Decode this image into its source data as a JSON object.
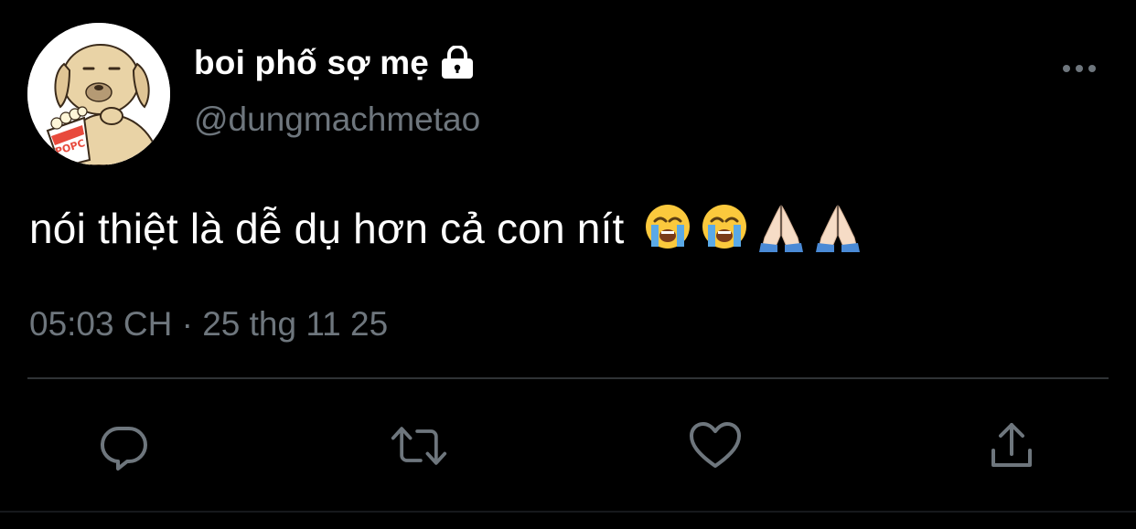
{
  "user": {
    "display_name": "boi phố sợ mẹ",
    "handle": "@dungmachmetao",
    "protected_icon": "lock-icon",
    "avatar_text": "POPC"
  },
  "tweet": {
    "text": "nói thiệt là dễ dụ hơn cả con nít",
    "emojis": [
      "loudly-crying-face",
      "loudly-crying-face",
      "folded-hands",
      "folded-hands"
    ],
    "timestamp": "05:03 CH · 25 thg 11 25"
  },
  "actions": [
    {
      "name": "reply",
      "icon": "reply-icon"
    },
    {
      "name": "retweet",
      "icon": "retweet-icon"
    },
    {
      "name": "like",
      "icon": "heart-icon"
    },
    {
      "name": "share",
      "icon": "share-icon"
    }
  ],
  "colors": {
    "background": "#000000",
    "text": "#ffffff",
    "secondary_text": "#6e767d",
    "divider": "#2f3336",
    "icon": "#6e767d"
  }
}
